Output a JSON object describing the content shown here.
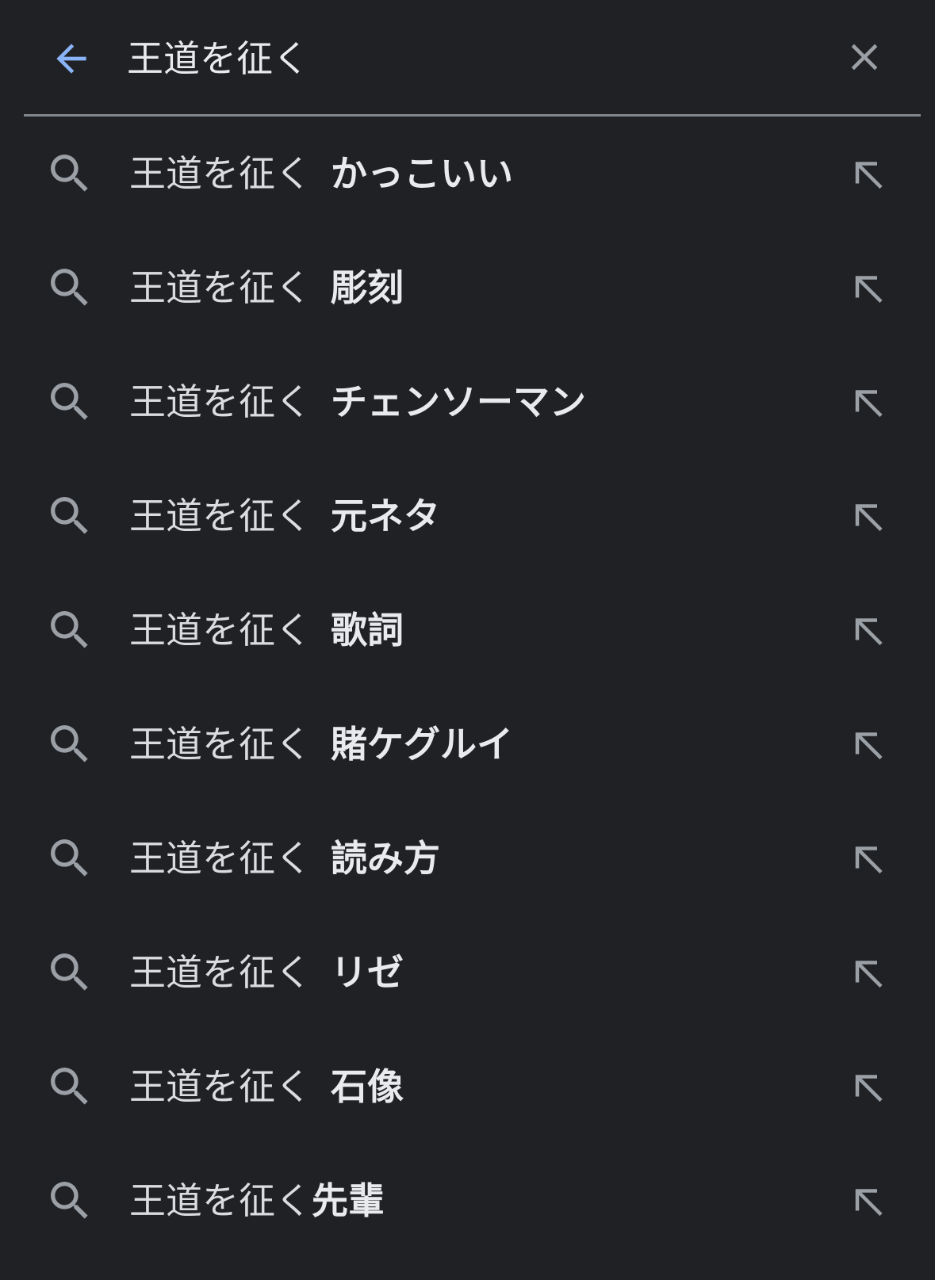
{
  "search": {
    "query": "王道を征く",
    "colors": {
      "accent": "#8ab4f8",
      "background": "#202124",
      "icon": "#9aa0a6",
      "divider": "#80868b"
    },
    "back_icon": "arrow-left-icon",
    "clear_icon": "close-icon"
  },
  "suggestions": [
    {
      "prefix": "王道を征く",
      "suffix": "かっこいい",
      "spaced": true
    },
    {
      "prefix": "王道を征く",
      "suffix": "彫刻",
      "spaced": true
    },
    {
      "prefix": "王道を征く",
      "suffix": "チェンソーマン",
      "spaced": true
    },
    {
      "prefix": "王道を征く",
      "suffix": "元ネタ",
      "spaced": true
    },
    {
      "prefix": "王道を征く",
      "suffix": "歌詞",
      "spaced": true
    },
    {
      "prefix": "王道を征く",
      "suffix": "賭ケグルイ",
      "spaced": true
    },
    {
      "prefix": "王道を征く",
      "suffix": "読み方",
      "spaced": true
    },
    {
      "prefix": "王道を征く",
      "suffix": "リゼ",
      "spaced": true
    },
    {
      "prefix": "王道を征く",
      "suffix": "石像",
      "spaced": true
    },
    {
      "prefix": "王道を征く",
      "suffix": "先輩",
      "spaced": false
    }
  ]
}
